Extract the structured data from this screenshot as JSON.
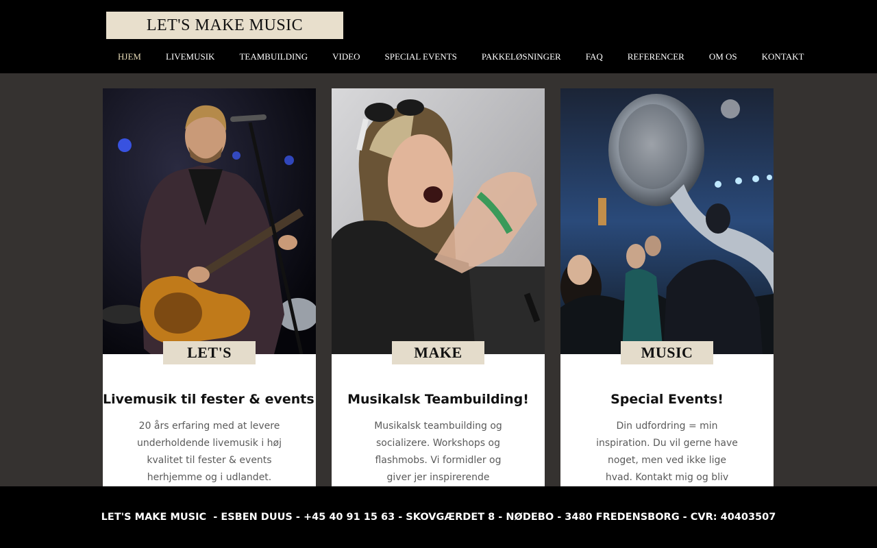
{
  "brand": {
    "logo_text": "LET'S MAKE MUSIC"
  },
  "nav": {
    "items": [
      {
        "label": "HJEM"
      },
      {
        "label": "LIVEMUSIK"
      },
      {
        "label": "TEAMBUILDING"
      },
      {
        "label": "VIDEO"
      },
      {
        "label": "SPECIAL EVENTS"
      },
      {
        "label": "PAKKELØSNINGER"
      },
      {
        "label": "FAQ"
      },
      {
        "label": "REFERENCER"
      },
      {
        "label": "OM OS"
      },
      {
        "label": "KONTAKT"
      }
    ],
    "active_index": 0
  },
  "cards": [
    {
      "tag": "LET'S",
      "heading": "Livemusik til fester & events!",
      "body": "20 års erfaring med at levere underholdende livemusik i høj kvalitet til fester & events herhjemme og i udlandet.",
      "photo": "singer-with-guitar-photo"
    },
    {
      "tag": "MAKE",
      "heading": "Musikalsk Teambuilding!",
      "body": "Musikalsk teambuilding og socializere. Workshops og flashmobs. Vi formidler og giver jer inspirerende fællesoplevelser.",
      "photo": "enthusiastic-woman-photo"
    },
    {
      "tag": "MUSIC",
      "heading": "Special Events!",
      "body": "Din udfordring = min inspiration. Du vil gerne have noget, men ved ikke lige hvad. Kontakt mig og bliv inspireret.",
      "photo": "sousaphone-party-photo"
    }
  ],
  "footer": {
    "text": "LET'S MAKE MUSIC  - ESBEN DUUS - +45 40 91 15 63 - SKOVGÆRDET 8 - NØDEBO - 3480 FREDENSBORG - CVR: 40403507"
  },
  "colors": {
    "header_bg": "#000000",
    "page_bg": "#353230",
    "logo_bg": "#e8dfcc",
    "nav_active": "#e8dcb8",
    "tag_bg": "#e4dccb"
  }
}
